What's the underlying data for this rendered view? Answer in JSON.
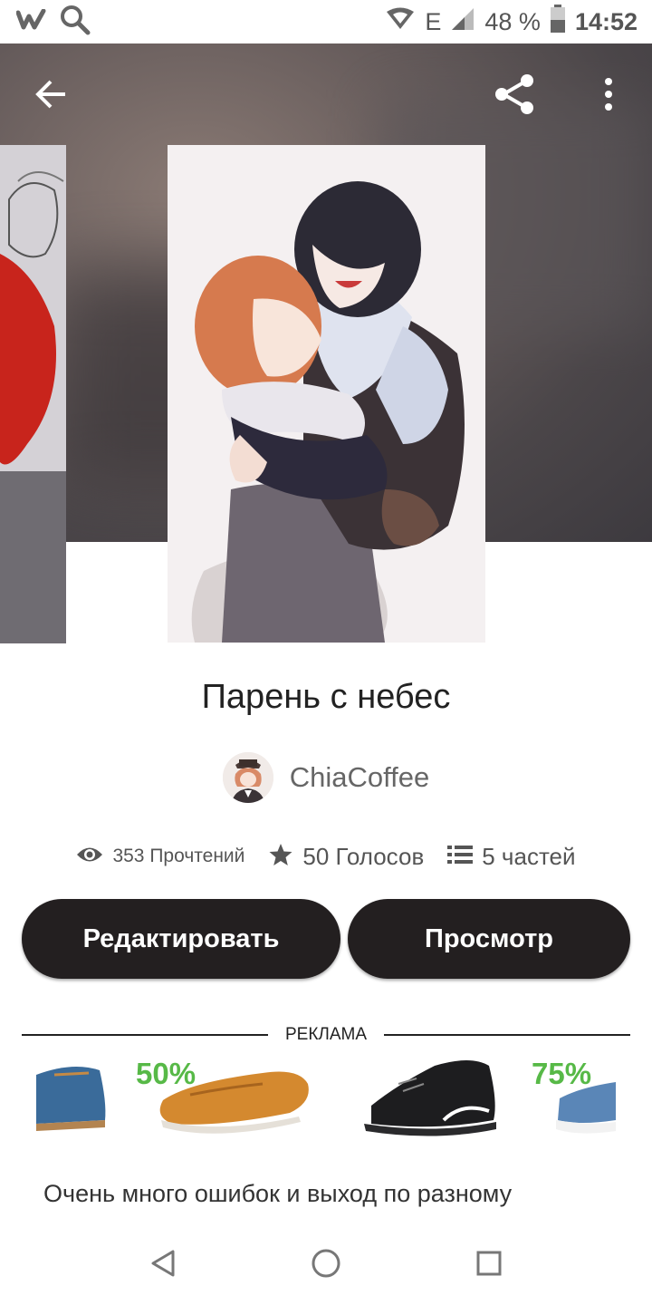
{
  "status_bar": {
    "battery": "48 %",
    "time": "14:52",
    "network": "E"
  },
  "story": {
    "title": "Парень с небес",
    "author": "ChiaCoffee",
    "stats": {
      "reads": "353 Прочтений",
      "votes": "50 Голосов",
      "parts": "5 частей"
    },
    "description": "Очень много ошибок и выход по разному"
  },
  "actions": {
    "edit_label": "Редактировать",
    "view_label": "Просмотр"
  },
  "ad": {
    "label": "РЕКЛАМА",
    "discounts": [
      "50%",
      "75%"
    ]
  },
  "colors": {
    "button_bg": "#231f20",
    "discount_green": "#57b947"
  }
}
